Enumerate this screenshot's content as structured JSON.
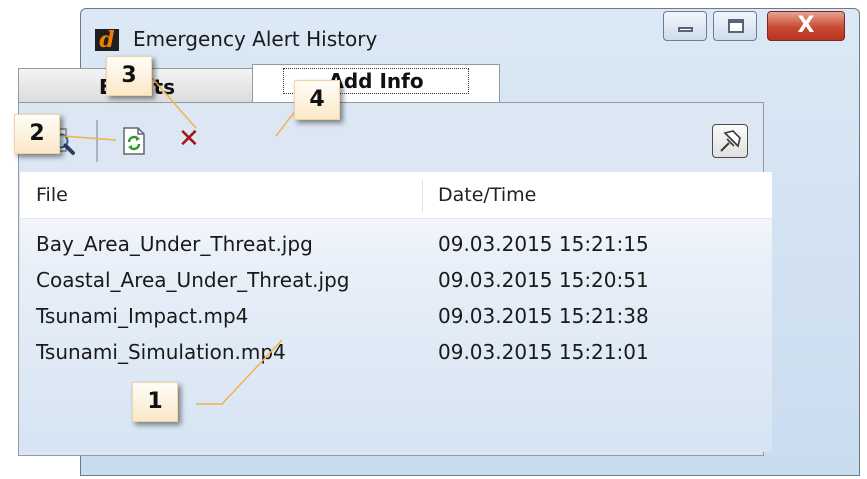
{
  "window": {
    "title": "Emergency Alert History",
    "logo_letter": "d",
    "controls": {
      "close_glyph": "X"
    }
  },
  "tabs": [
    {
      "label": "Events",
      "active": false
    },
    {
      "label": "Add Info",
      "active": true
    }
  ],
  "toolbar": {
    "items": [
      "search-icon",
      "refresh-document-icon",
      "delete-icon",
      "pin-icon"
    ],
    "delete_glyph": "✕"
  },
  "table": {
    "columns": [
      "File",
      "Date/Time"
    ],
    "rows": [
      {
        "file": "Bay_Area_Under_Threat.jpg",
        "datetime": "09.03.2015 15:21:15"
      },
      {
        "file": "Coastal_Area_Under_Threat.jpg",
        "datetime": "09.03.2015 15:20:51"
      },
      {
        "file": "Tsunami_Impact.mp4",
        "datetime": "09.03.2015 15:21:38"
      },
      {
        "file": "Tsunami_Simulation.mp4",
        "datetime": "09.03.2015 15:21:01"
      }
    ]
  },
  "callouts": [
    "1",
    "2",
    "3",
    "4"
  ],
  "colors": {
    "callout_line": "#f5b24a",
    "delete": "#a3141b",
    "logo_letter": "#f07d00"
  }
}
